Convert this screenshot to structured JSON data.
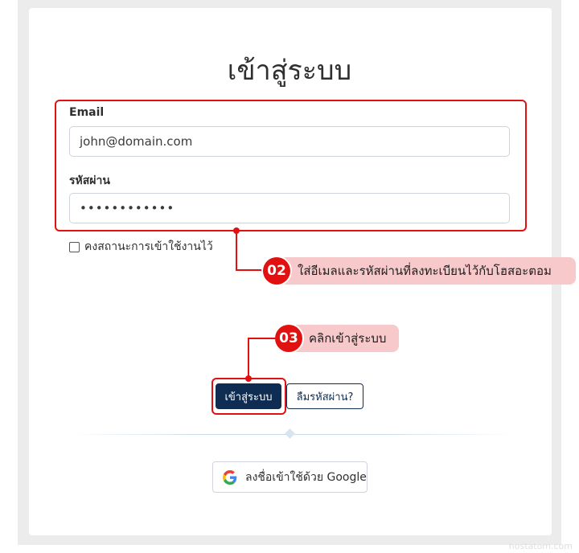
{
  "login": {
    "title": "เข้าสู่ระบบ",
    "email_label": "Email",
    "email_value": "john@domain.com",
    "password_label": "รหัสผ่าน",
    "password_value": "••••••••••••",
    "remember_label": "คงสถานะการเข้าใช้งานไว้",
    "submit_label": "เข้าสู่ระบบ",
    "forgot_label": "ลืมรหัสผ่าน?",
    "google_label": "ลงชื่อเข้าใช้ด้วย Google"
  },
  "annotations": {
    "step2_number": "02",
    "step2_text": "ใส่อีเมลและรหัสผ่านที่ลงทะเบียนไว้กับโฮสอะตอม",
    "step3_number": "03",
    "step3_text": "คลิกเข้าสู่ระบบ",
    "highlight_color": "#e11111",
    "callout_bg": "#f7c9cb"
  },
  "watermark": "hostatom.com"
}
